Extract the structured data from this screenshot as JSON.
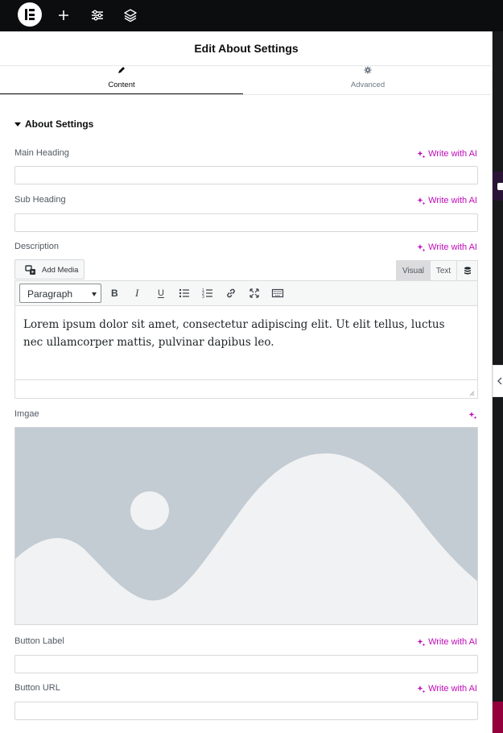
{
  "topbar": {
    "icons": [
      "elementor-logo-icon",
      "plus-icon",
      "sliders-icon",
      "layers-icon"
    ]
  },
  "panel": {
    "title": "Edit About Settings",
    "tabs": [
      {
        "label": "Content",
        "icon": "pencil-icon",
        "active": true
      },
      {
        "label": "Advanced",
        "icon": "gear-icon",
        "active": false
      }
    ]
  },
  "section": {
    "title": "About Settings"
  },
  "ai_label": "Write with AI",
  "controls": {
    "main_heading": {
      "label": "Main Heading",
      "value": ""
    },
    "sub_heading": {
      "label": "Sub Heading",
      "value": ""
    },
    "description": {
      "label": "Description",
      "add_media": "Add Media",
      "mode_visual": "Visual",
      "mode_text": "Text",
      "format": "Paragraph",
      "content": "Lorem ipsum dolor sit amet, consectetur adipiscing elit. Ut elit tellus, luctus nec ullamcorper mattis, pulvinar dapibus leo."
    },
    "image": {
      "label": "Imgae"
    },
    "button_label": {
      "label": "Button Label",
      "value": ""
    },
    "button_url": {
      "label": "Button URL",
      "value": ""
    }
  },
  "colors": {
    "accent_ai": "#c00bb9",
    "topbar_bg": "#0c0d0e",
    "placeholder_bg": "#c3cbd3",
    "placeholder_fg": "#f1f2f3"
  }
}
